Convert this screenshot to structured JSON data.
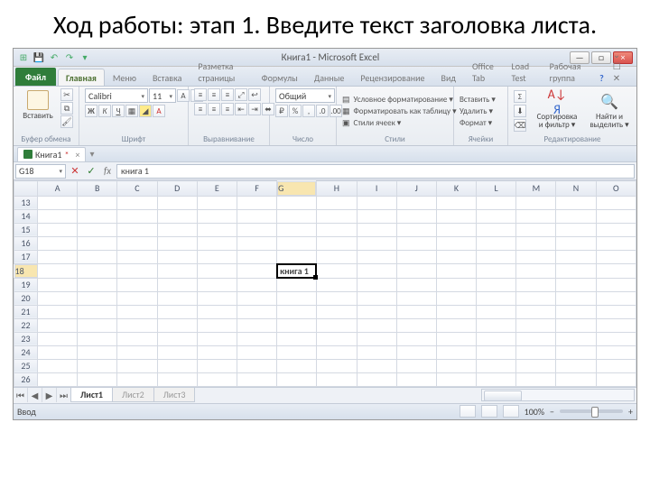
{
  "slide_title": "Ход работы: этап 1. Введите текст заголовка листа.",
  "titlebar": {
    "title": "Книга1 - Microsoft Excel",
    "min": "—",
    "max": "□",
    "close": "×"
  },
  "tabs": {
    "file": "Файл",
    "items": [
      "Главная",
      "Меню",
      "Вставка",
      "Разметка страницы",
      "Формулы",
      "Данные",
      "Рецензирование",
      "Вид",
      "Office Tab",
      "Load Test",
      "Рабочая группа"
    ],
    "active": 0,
    "help": "?",
    "extra": "⌄ ☐ ✕"
  },
  "ribbon": {
    "clipboard": {
      "paste": "Вставить",
      "label": "Буфер обмена"
    },
    "font": {
      "name": "Calibri",
      "size": "11",
      "label": "Шрифт",
      "bold": "Ж",
      "italic": "К",
      "under": "Ч"
    },
    "align": {
      "label": "Выравнивание"
    },
    "number": {
      "sel": "Общий",
      "label": "Число"
    },
    "styles": {
      "a": "Условное форматирование ▾",
      "b": "Форматировать как таблицу ▾",
      "c": "Стили ячеек ▾",
      "label": "Стили"
    },
    "cells": {
      "ins": "Вставить ▾",
      "del": "Удалить ▾",
      "fmt": "Формат ▾",
      "label": "Ячейки"
    },
    "editing": {
      "sort": "Сортировка и фильтр ▾",
      "find": "Найти и выделить ▾",
      "label": "Редактирование"
    }
  },
  "booktab": {
    "name": "Книга1",
    "mark": "*",
    "x": "×"
  },
  "formula": {
    "namebox": "G18",
    "dd": "▾",
    "cancel": "✕",
    "ok": "✓",
    "fx": "fx",
    "value": "книга 1"
  },
  "grid": {
    "cols": [
      "A",
      "B",
      "C",
      "D",
      "E",
      "F",
      "G",
      "H",
      "I",
      "J",
      "K",
      "L",
      "M",
      "N",
      "O"
    ],
    "rows": [
      "13",
      "14",
      "15",
      "16",
      "17",
      "18",
      "19",
      "20",
      "21",
      "22",
      "23",
      "24",
      "25",
      "26"
    ],
    "active_col": 6,
    "active_row": 5,
    "cell_value": "книга 1"
  },
  "sheets": {
    "items": [
      "Лист1",
      "Лист2",
      "Лист3"
    ],
    "active": 0,
    "nav": [
      "⏮",
      "◀",
      "▶",
      "⏭"
    ]
  },
  "status": {
    "mode": "Ввод",
    "zoom": "100%",
    "minus": "−",
    "plus": "+"
  }
}
